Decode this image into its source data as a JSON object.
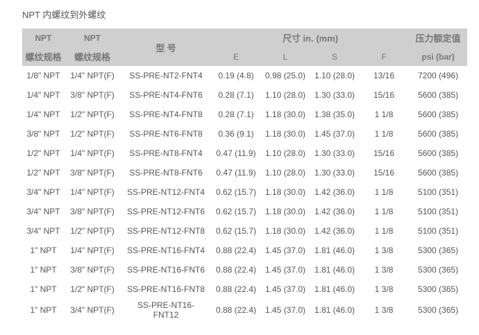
{
  "page": {
    "title": "NPT 内螺纹到外螺纹"
  },
  "table": {
    "header": {
      "col1_top": "NPT",
      "col1_bottom": "螺纹规格",
      "col2_top": "NPT",
      "col2_bottom": "螺纹规格",
      "model": "型 号",
      "dimensions": "尺寸 in. (mm)",
      "pressure_top": "压力额定值",
      "E": "E",
      "L": "L",
      "S": "S",
      "F": "F",
      "pressure_bottom": "psi (bar)"
    },
    "rows": [
      {
        "npt1": "1/8\" NPT",
        "npt2": "1/4\" NPT(F)",
        "model": "SS-PRE-NT2-FNT4",
        "e": "0.19 (4.8)",
        "l": "0.98 (25.0)",
        "s": "1.10 (28.0)",
        "f": "13/16",
        "p": "7200 (496)"
      },
      {
        "npt1": "1/4\" NPT",
        "npt2": "3/8\" NPT(F)",
        "model": "SS-PRE-NT4-FNT6",
        "e": "0.28 (7.1)",
        "l": "1.10 (28.0)",
        "s": "1.30 (33.0)",
        "f": "15/16",
        "p": "5600 (385)"
      },
      {
        "npt1": "1/4\" NPT",
        "npt2": "1/2\" NPT(F)",
        "model": "SS-PRE-NT4-FNT8",
        "e": "0.28 (7.1)",
        "l": "1.18 (30.0)",
        "s": "1.38 (35.0)",
        "f": "1 1/8",
        "p": "5600 (385)"
      },
      {
        "npt1": "3/8\" NPT",
        "npt2": "1/2\" NPT(F)",
        "model": "SS-PRE-NT6-FNT8",
        "e": "0.36 (9.1)",
        "l": "1.18 (30.0)",
        "s": "1.45 (37.0)",
        "f": "1 1/8",
        "p": "5600 (385)"
      },
      {
        "npt1": "1/2\" NPT",
        "npt2": "1/4\" NPT(F)",
        "model": "SS-PRE-NT8-FNT4",
        "e": "0.47 (11.9)",
        "l": "1.10 (28.0)",
        "s": "1.30 (33.0)",
        "f": "15/16",
        "p": "5600 (385)"
      },
      {
        "npt1": "1/2\" NPT",
        "npt2": "3/8\" NPT(F)",
        "model": "SS-PRE-NT8-FNT6",
        "e": "0.47 (11.9)",
        "l": "1.10 (28.0)",
        "s": "1.30 (33.0)",
        "f": "15/16",
        "p": "5600 (385)"
      },
      {
        "npt1": "3/4\" NPT",
        "npt2": "1/4\" NPT(F)",
        "model": "SS-PRE-NT12-FNT4",
        "e": "0.62 (15.7)",
        "l": "1.18 (30.0)",
        "s": "1.42 (36.0)",
        "f": "1 1/8",
        "p": "5100 (351)"
      },
      {
        "npt1": "3/4\" NPT",
        "npt2": "3/8\" NPT(F)",
        "model": "SS-PRE-NT12-FNT6",
        "e": "0.62 (15.7)",
        "l": "1.18 (30.0)",
        "s": "1.42 (36.0)",
        "f": "1 1/8",
        "p": "5100 (351)"
      },
      {
        "npt1": "3/4\" NPT",
        "npt2": "1/2\" NPT(F)",
        "model": "SS-PRE-NT12-FNT8",
        "e": "0.62 (15.7)",
        "l": "1.18 (30.0)",
        "s": "1.42 (36.0)",
        "f": "1 1/8",
        "p": "5100 (351)"
      },
      {
        "npt1": "1\" NPT",
        "npt2": "1/4\" NPT(F)",
        "model": "SS-PRE-NT16-FNT4",
        "e": "0.88 (22.4)",
        "l": "1.45 (37.0)",
        "s": "1.81 (46.0)",
        "f": "1 3/8",
        "p": "5300 (365)"
      },
      {
        "npt1": "1\" NPT",
        "npt2": "3/8\" NPT(F)",
        "model": "SS-PRE-NT16-FNT6",
        "e": "0.88 (22.4)",
        "l": "1.45 (37.0)",
        "s": "1.81 (46.0)",
        "f": "1 3/8",
        "p": "5300 (365)"
      },
      {
        "npt1": "1\" NPT",
        "npt2": "1/2\" NPT(F)",
        "model": "SS-PRE-NT16-FNT8",
        "e": "0.88 (22.4)",
        "l": "1.45 (37.0)",
        "s": "1.81 (46.0)",
        "f": "1 3/8",
        "p": "5300 (365)"
      },
      {
        "npt1": "1\" NPT",
        "npt2": "3/4\" NPT(F)",
        "model": "SS-PRE-NT16-FNT12",
        "e": "0.88 (22.4)",
        "l": "1.45 (37.0)",
        "s": "1.81 (46.0)",
        "f": "1 3/8",
        "p": "5300 (365)"
      }
    ]
  }
}
